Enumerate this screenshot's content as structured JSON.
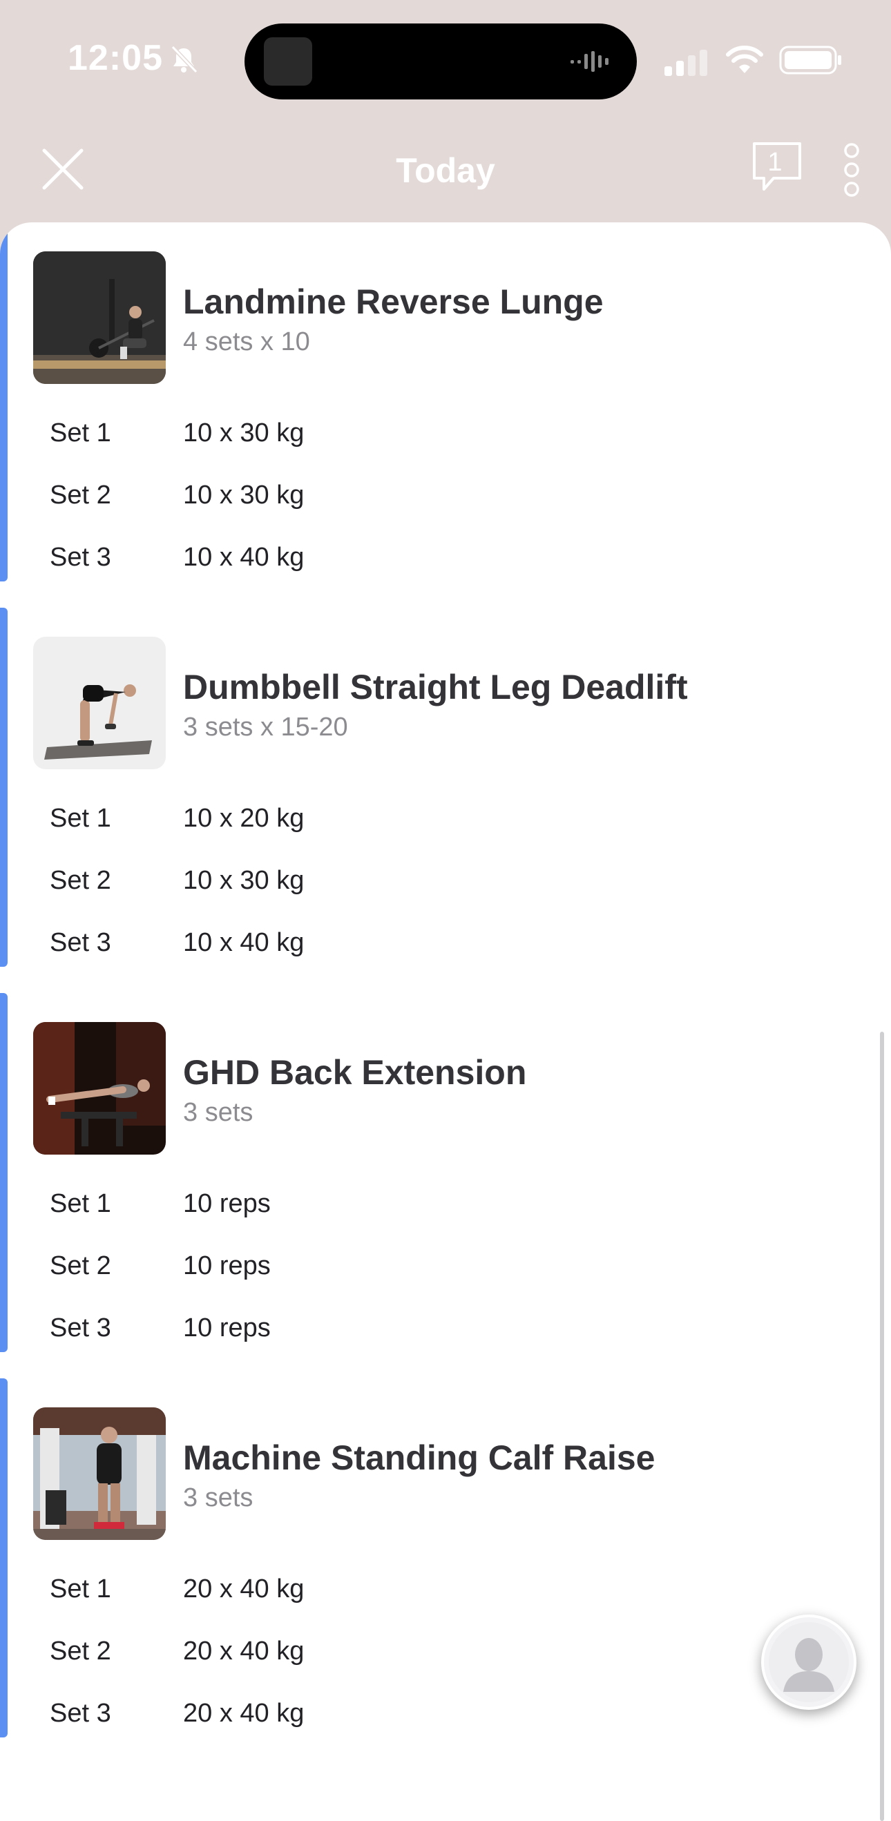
{
  "status_bar": {
    "time": "12:05"
  },
  "header": {
    "title": "Today",
    "comments_count": "1"
  },
  "exercises": [
    {
      "name": "Landmine Reverse Lunge",
      "summary": "4 sets x 10",
      "sets": [
        {
          "label": "Set 1",
          "value": "10 x 30 kg"
        },
        {
          "label": "Set 2",
          "value": "10 x 30 kg"
        },
        {
          "label": "Set 3",
          "value": "10 x 40 kg"
        }
      ]
    },
    {
      "name": "Dumbbell Straight Leg Deadlift",
      "summary": "3 sets x 15-20",
      "sets": [
        {
          "label": "Set 1",
          "value": "10 x 20 kg"
        },
        {
          "label": "Set 2",
          "value": "10 x 30 kg"
        },
        {
          "label": "Set 3",
          "value": "10 x 40 kg"
        }
      ]
    },
    {
      "name": "GHD Back Extension",
      "summary": "3 sets",
      "sets": [
        {
          "label": "Set 1",
          "value": "10 reps"
        },
        {
          "label": "Set 2",
          "value": "10 reps"
        },
        {
          "label": "Set 3",
          "value": "10 reps"
        }
      ]
    },
    {
      "name": "Machine Standing Calf Raise",
      "summary": "3 sets",
      "sets": [
        {
          "label": "Set 1",
          "value": "20 x 40 kg"
        },
        {
          "label": "Set 2",
          "value": "20 x 40 kg"
        },
        {
          "label": "Set 3",
          "value": "20 x 40 kg"
        }
      ]
    }
  ],
  "icons": {
    "close": "close-icon",
    "comments": "comment-bubble-icon",
    "more": "more-vertical-icon",
    "coach": "coach-avatar-icon"
  },
  "colors": {
    "header_bg": "#e3dad8",
    "accent": "#5b8ff2",
    "text_primary": "#333338",
    "text_secondary": "#8c8c90"
  }
}
